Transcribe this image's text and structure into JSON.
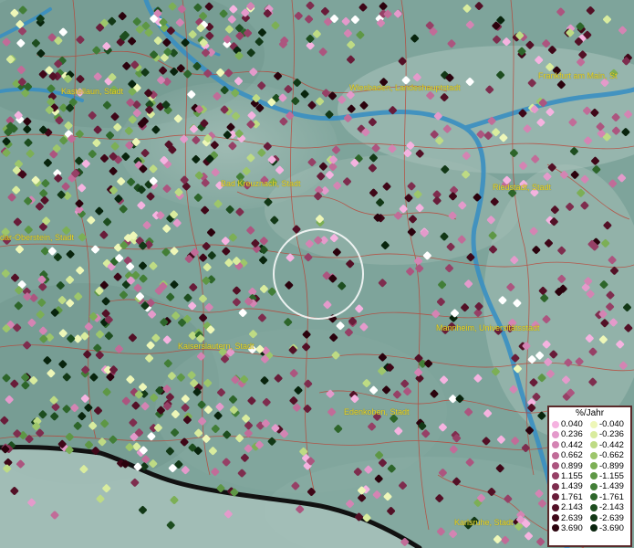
{
  "map": {
    "cities": [
      {
        "id": "kastellaun",
        "label": "Kastellaun, Stadt"
      },
      {
        "id": "wiesbaden",
        "label": "Wiesbaden, Landeshauptstadt"
      },
      {
        "id": "frankfurt",
        "label": "Frankfurt am Main, St"
      },
      {
        "id": "bad-kreuznach",
        "label": "Bad Kreuznach, Stadt"
      },
      {
        "id": "riedstadt",
        "label": "Riedstadt, Stadt"
      },
      {
        "id": "idar-oberstein",
        "label": "dar-Oberstein, Stadt"
      },
      {
        "id": "mannheim",
        "label": "Mannheim, Universitätsstadt"
      },
      {
        "id": "kaiserslautern",
        "label": "Kaiserslautern, Stadt"
      },
      {
        "id": "edenkoben",
        "label": "Edenkoben, Stadt"
      },
      {
        "id": "karlsruhe",
        "label": "Karlsruhe, Stadt"
      }
    ],
    "colors": {
      "terrain": "#7fa59d",
      "river": "#3a8fc2",
      "boundary": "#c0392b",
      "label": "#e8d62a",
      "border": "#111111"
    }
  },
  "legend": {
    "title": "%/Jahr",
    "positive": [
      {
        "value": "0.040",
        "color": "#f5b3e0"
      },
      {
        "value": "0.236",
        "color": "#e49acb"
      },
      {
        "value": "0.442",
        "color": "#d484b3"
      },
      {
        "value": "0.662",
        "color": "#c16c98"
      },
      {
        "value": "0.899",
        "color": "#ac557f"
      },
      {
        "value": "1.155",
        "color": "#964066"
      },
      {
        "value": "1.439",
        "color": "#7e2d4e"
      },
      {
        "value": "1.761",
        "color": "#681c39"
      },
      {
        "value": "2.143",
        "color": "#531026"
      },
      {
        "value": "2.639",
        "color": "#3f0718"
      },
      {
        "value": "3.690",
        "color": "#2b020d"
      }
    ],
    "negative": [
      {
        "value": "-0.040",
        "color": "#eef7b8"
      },
      {
        "value": "-0.236",
        "color": "#d9ec9e"
      },
      {
        "value": "-0.442",
        "color": "#bedb84"
      },
      {
        "value": "-0.662",
        "color": "#9dc66b"
      },
      {
        "value": "-0.899",
        "color": "#7caf55"
      },
      {
        "value": "-1.155",
        "color": "#5e9745"
      },
      {
        "value": "-1.439",
        "color": "#427e37"
      },
      {
        "value": "-1.761",
        "color": "#2d652a"
      },
      {
        "value": "-2.143",
        "color": "#1d4d1f"
      },
      {
        "value": "-2.639",
        "color": "#123816"
      },
      {
        "value": "-3.690",
        "color": "#08240d"
      }
    ]
  }
}
